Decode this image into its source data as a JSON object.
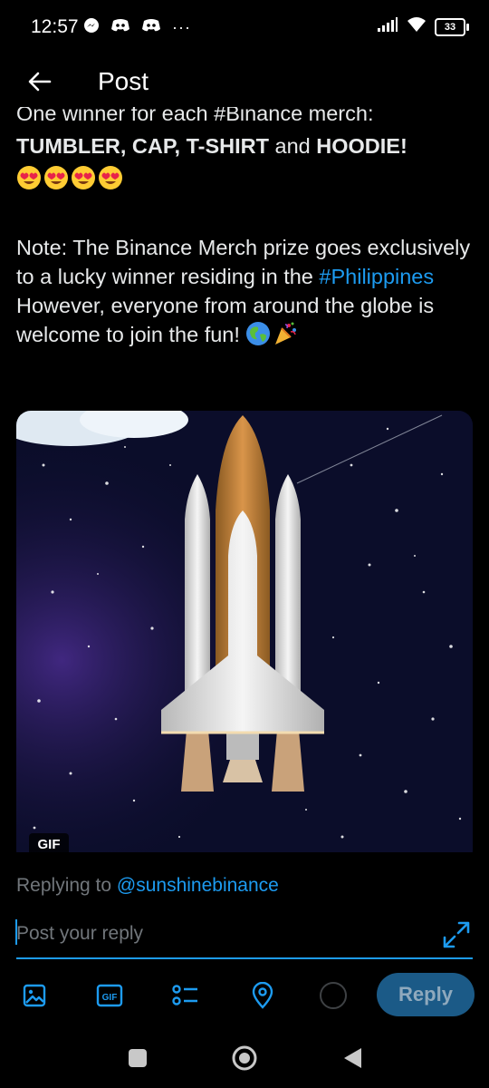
{
  "status_bar": {
    "time": "12:57",
    "dots": "···",
    "battery": "33"
  },
  "header": {
    "title": "Post",
    "back_icon": "arrow-left-icon"
  },
  "post": {
    "cut_line": "One winner for each #Binance merch:",
    "prizes": {
      "tumbler_cap_tshirt": "TUMBLER, CAP, T-SHIRT",
      "and": " and ",
      "hoodie": "HOODIE!"
    },
    "note_before": "Note: The Binance Merch prize goes exclusively to a lucky winner residing in the ",
    "note_hashtag": "#Philippines",
    "note_after": " However, everyone from around the globe is welcome to join the fun! ",
    "media": {
      "badge": "GIF"
    }
  },
  "reply": {
    "replying_prefix": "Replying to ",
    "handle": "@sunshinebinance",
    "placeholder": "Post your reply",
    "button_label": "Reply",
    "toolbar_icons": [
      "image-icon",
      "gif-icon",
      "poll-icon",
      "location-icon"
    ]
  },
  "colors": {
    "accent": "#1d9bf0",
    "background": "#000000",
    "text": "#e7e9ea",
    "muted": "#71767b",
    "reply_button": "#1b5a87"
  }
}
